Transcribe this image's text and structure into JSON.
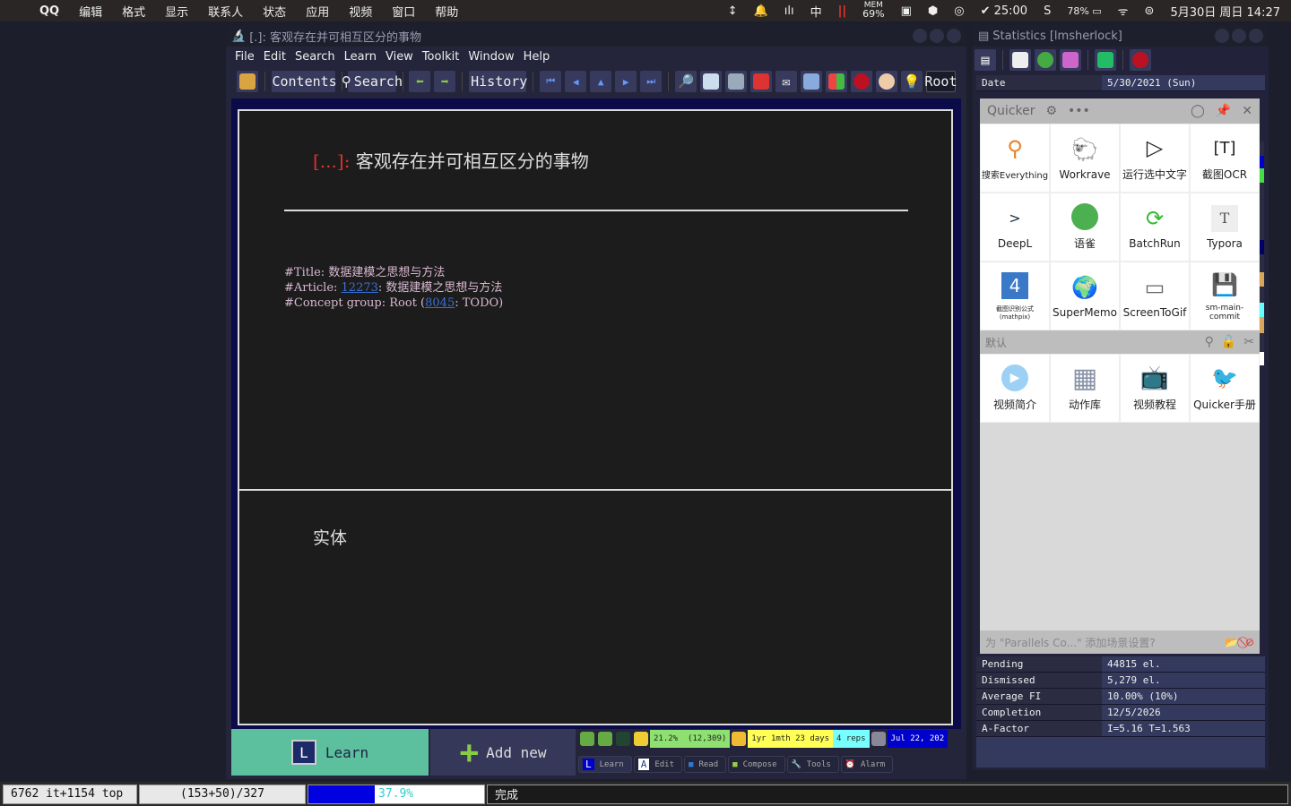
{
  "menubar": {
    "app": "QQ",
    "items": [
      "编辑",
      "格式",
      "显示",
      "联系人",
      "状态",
      "应用",
      "视频",
      "窗口",
      "帮助"
    ],
    "ime": "中",
    "mem_label": "MEM",
    "mem": "69%",
    "timer": "25:00",
    "battery": "78%",
    "datetime": "5月30日 周日 14:27"
  },
  "smwindow": {
    "title": "[.]: 客观存在并可相互区分的事物",
    "menu": [
      "File",
      "Edit",
      "Search",
      "Learn",
      "View",
      "Toolkit",
      "Window",
      "Help"
    ],
    "toolbar": {
      "contents": "Contents",
      "search": "Search",
      "history": "History",
      "root": "Root"
    },
    "element": {
      "question_prefix": "[...]",
      "question_sep": ":",
      "question": "客观存在并可相互区分的事物",
      "ref_title_label": "#Title:",
      "ref_title": "数据建模之思想与方法",
      "ref_article_label": "#Article:",
      "ref_article_id": "12273",
      "ref_article": ": 数据建模之思想与方法",
      "ref_concept_label": "#Concept group: Root (",
      "ref_concept_id": "8045",
      "ref_concept": ": TODO)",
      "answer": "实体"
    },
    "learn_label": "Learn",
    "add_new_label": "Add new",
    "strip": {
      "priority": "21.2%",
      "priority_pos": "(12,309)",
      "interval": "1yr 1mth 23 days",
      "reps": "4 reps",
      "date": "Jul 22, 202"
    },
    "tabs": [
      "Learn",
      "Edit",
      "Read",
      "Compose",
      "Tools",
      "Alarm"
    ],
    "colors": {
      "learn": "#5cbf9e",
      "content_border": "#0b0b4a",
      "link": "#3a6fd6",
      "question_prefix": "#e0302a"
    }
  },
  "stats": {
    "title": "Statistics [lmsherlock]",
    "top_rows": [
      {
        "k": "Date",
        "v": "5/30/2021 (Sun)"
      }
    ],
    "rows": [
      {
        "k": "Pending",
        "v": "44815 el."
      },
      {
        "k": "Dismissed",
        "v": "5,279 el."
      },
      {
        "k": "Average FI",
        "v": "10.00% (10%)"
      },
      {
        "k": "Completion",
        "v": "12/5/2026"
      },
      {
        "k": "A-Factor",
        "v": "I=5.16 T=1.563"
      }
    ]
  },
  "quicker": {
    "title": "Quicker",
    "apps": [
      "搜索Everything",
      "Workrave",
      "运行选中文字",
      "截图OCR",
      "DeepL",
      "语雀",
      "BatchRun",
      "Typora",
      "截图识别公式(mathpix)",
      "SuperMemo",
      "ScreenToGif",
      "sm-main-commit"
    ],
    "section": "默认",
    "section_apps": [
      "视频简介",
      "动作库",
      "视频教程",
      "Quicker手册"
    ],
    "footer": "为 \"Parallels Co...\" 添加场景设置?"
  },
  "statusbar": {
    "items": "6762 it+1154 top",
    "outstanding": "(153+50)/327",
    "progress_pct": 37.9,
    "progress_label": "37.9%",
    "status": "完成"
  }
}
